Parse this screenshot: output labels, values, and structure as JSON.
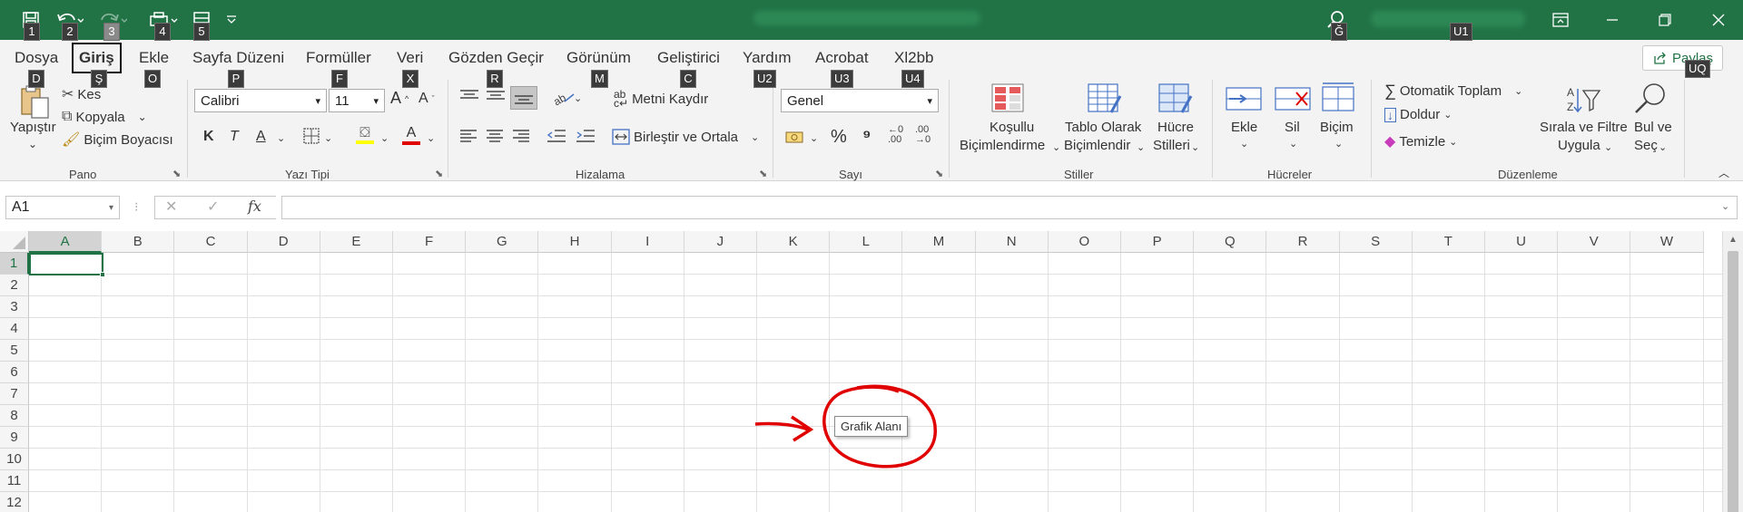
{
  "title_bar": {
    "keytips": [
      "1",
      "2",
      "3",
      "4",
      "5"
    ],
    "search_keytip": "Ğ",
    "account_keytip": "U1"
  },
  "tabs": [
    {
      "label": "Dosya",
      "keytip": "D"
    },
    {
      "label": "Giriş",
      "keytip": "Ş",
      "active": true
    },
    {
      "label": "Ekle",
      "keytip": "O"
    },
    {
      "label": "Sayfa Düzeni",
      "keytip": "P"
    },
    {
      "label": "Formüller",
      "keytip": "F"
    },
    {
      "label": "Veri",
      "keytip": "X"
    },
    {
      "label": "Gözden Geçir",
      "keytip": "R"
    },
    {
      "label": "Görünüm",
      "keytip": "M"
    },
    {
      "label": "Geliştirici",
      "keytip": "C"
    },
    {
      "label": "Yardım",
      "keytip": "U2"
    },
    {
      "label": "Acrobat",
      "keytip": "U3"
    },
    {
      "label": "Xl2bb",
      "keytip": "U4"
    }
  ],
  "share": {
    "label": "Paylaş",
    "keytip": "UQ"
  },
  "ribbon": {
    "clipboard": {
      "group": "Pano",
      "paste": "Yapıştır",
      "cut": "Kes",
      "copy": "Kopyala",
      "format_painter": "Biçim Boyacısı"
    },
    "font": {
      "group": "Yazı Tipi",
      "font_name": "Calibri",
      "font_size": "11",
      "bold": "K",
      "italic": "T",
      "underline": "A"
    },
    "alignment": {
      "group": "Hizalama",
      "wrap_text": "Metni Kaydır",
      "merge_center": "Birleştir ve Ortala"
    },
    "number": {
      "group": "Sayı",
      "format": "Genel",
      "percent": "%",
      "comma": "⁹"
    },
    "styles": {
      "group": "Stiller",
      "conditional_1": "Koşullu",
      "conditional_2": "Biçimlendirme",
      "table_1": "Tablo Olarak",
      "table_2": "Biçimlendir",
      "cell_1": "Hücre",
      "cell_2": "Stilleri"
    },
    "cells": {
      "group": "Hücreler",
      "insert": "Ekle",
      "delete": "Sil",
      "format": "Biçim"
    },
    "editing": {
      "group": "Düzenleme",
      "autosum": "Otomatik Toplam",
      "fill": "Doldur",
      "clear": "Temizle",
      "sort_1": "Sırala ve Filtre",
      "sort_2": "Uygula",
      "find_1": "Bul ve",
      "find_2": "Seç"
    }
  },
  "formula_bar": {
    "name_box": "A1",
    "fx": "fx",
    "cancel": "✕",
    "enter": "✓"
  },
  "columns": [
    "A",
    "B",
    "C",
    "D",
    "E",
    "F",
    "G",
    "H",
    "I",
    "J",
    "K",
    "L",
    "M",
    "N",
    "O",
    "P",
    "Q",
    "R",
    "S",
    "T",
    "U",
    "V",
    "W"
  ],
  "rows": [
    "1",
    "2",
    "3",
    "4",
    "5",
    "6",
    "7",
    "8",
    "9",
    "10",
    "11",
    "12"
  ],
  "tooltip": "Grafik Alanı",
  "colors": {
    "titlebar": "#217346",
    "annotation": "#e00000"
  }
}
